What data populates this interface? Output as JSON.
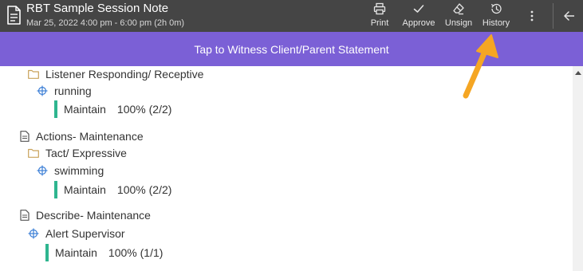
{
  "header": {
    "title": "RBT Sample Session Note",
    "subtitle": "Mar 25, 2022 4:00 pm - 6:00 pm (2h 0m)",
    "toolbar": {
      "print_label": "Print",
      "approve_label": "Approve",
      "unsign_label": "Unsign",
      "history_label": "History"
    }
  },
  "banner": {
    "text": "Tap to Witness Client/Parent Statement"
  },
  "tree": {
    "listener_folder": "Listener Responding/ Receptive",
    "running_target": "running",
    "running_metric": {
      "label": "Maintain",
      "value": "100% (2/2)"
    },
    "actions_doc": "Actions- Maintenance",
    "tact_folder": "Tact/ Expressive",
    "swimming_target": "swimming",
    "swimming_metric": {
      "label": "Maintain",
      "value": "100% (2/2)"
    },
    "describe_doc": "Describe- Maintenance",
    "alert_target": "Alert Supervisor",
    "alert_metric": {
      "label": "Maintain",
      "value": "100% (1/1)"
    }
  },
  "colors": {
    "header_bg": "#454545",
    "banner_bg": "#7b60d6",
    "metric_bar": "#2eb58f",
    "target_icon": "#3b7ed6",
    "folder_icon": "#c9a25a",
    "annotation_arrow": "#f5a623"
  }
}
